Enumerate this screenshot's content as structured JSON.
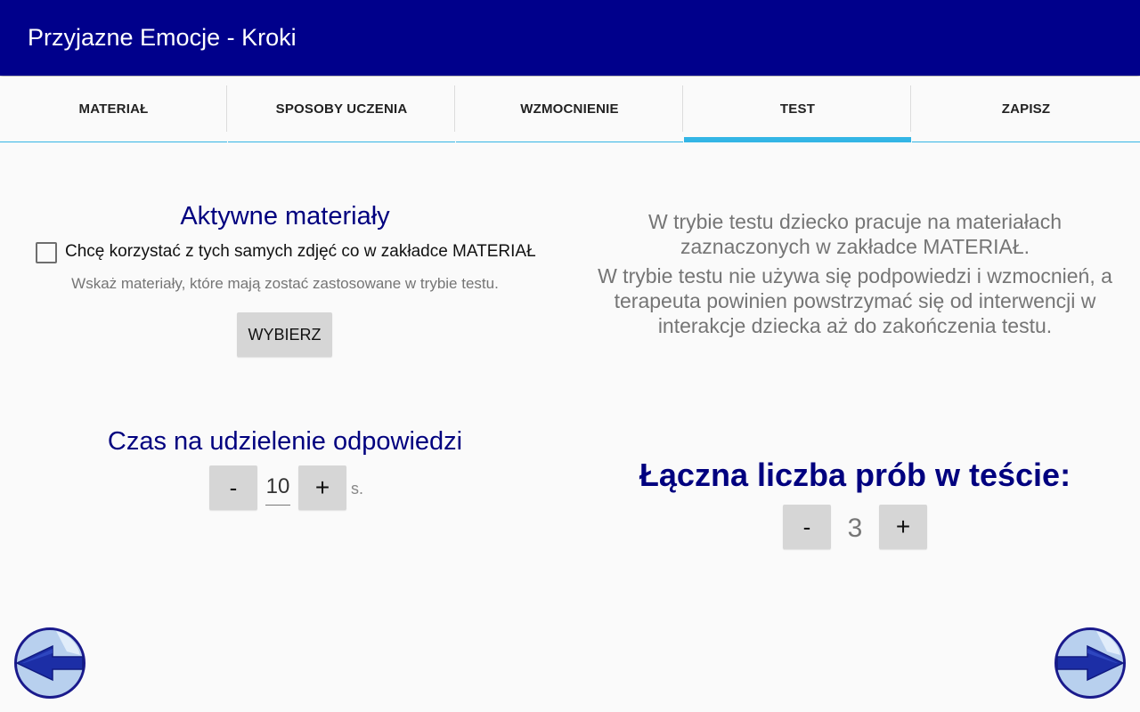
{
  "appbar": {
    "title": "Przyjazne Emocje - Kroki"
  },
  "tabs": [
    {
      "label": "MATERIAŁ",
      "active": false
    },
    {
      "label": "SPOSOBY UCZENIA",
      "active": false
    },
    {
      "label": "WZMOCNIENIE",
      "active": false
    },
    {
      "label": "TEST",
      "active": true
    },
    {
      "label": "ZAPISZ",
      "active": false
    }
  ],
  "materials": {
    "heading": "Aktywne materiały",
    "checkbox_label": "Chcę korzystać z tych samych zdjęć co w zakładce MATERIAŁ",
    "checkbox_checked": false,
    "hint": "Wskaż materiały, które mają zostać zastosowane w trybie testu.",
    "choose_button": "WYBIERZ"
  },
  "info": {
    "line1": "W trybie testu dziecko pracuje na materiałach zaznaczonych w zakładce MATERIAŁ.",
    "line2": "W trybie testu nie używa się podpowiedzi i wzmocnień, a terapeuta powinien powstrzymać się od interwencji w interakcje dziecka aż do zakończenia testu."
  },
  "response_time": {
    "heading": "Czas na udzielenie odpowiedzi",
    "minus": "-",
    "value": "10",
    "plus": "+",
    "unit": "s."
  },
  "trials": {
    "heading": "Łączna liczba prób w teście:",
    "minus": "-",
    "value": "3",
    "plus": "+"
  },
  "icons": {
    "back": "back-arrow-icon",
    "forward": "forward-arrow-icon"
  },
  "colors": {
    "appbar": "#00008b",
    "heading": "#00007f",
    "tab_indicator": "#33b5e5",
    "button": "#d6d6d6",
    "nav_circle": "#b8d0ee"
  }
}
